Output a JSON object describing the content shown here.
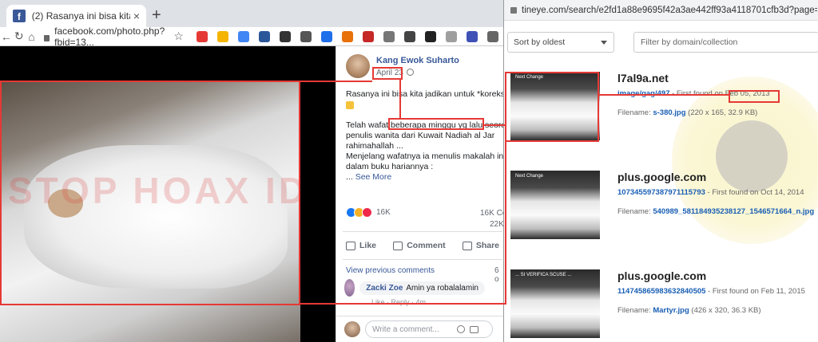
{
  "left_browser": {
    "tab_title": "(2) Rasanya ini bisa kita jadikan",
    "tab_favicon_letter": "f",
    "tab_close": "×",
    "new_tab": "+",
    "url": "facebook.com/photo.php?fbid=13...",
    "back": "←",
    "reload": "↻",
    "home": "⌂",
    "star": "☆"
  },
  "photo": {
    "watermark": "STOP HOAX ID"
  },
  "post": {
    "author": "Kang Ewok Suharto",
    "date": "April 23",
    "line1": "Rasanya ini bisa kita jadikan untuk *koreksi",
    "line3": "Telah wafat beberapa minggu yg lalu seorang",
    "line4": "penulis wanita dari Kuwait Nadiah al Jar",
    "line5": "rahimahallah ...",
    "line6": "Menjelang wafatnya ia menulis makalah ini d",
    "line7": "dalam buku hariannya :",
    "ellipsis": "...",
    "see_more": "See More",
    "reaction_count": "16K",
    "comments_count": "16K Co",
    "shares_count": "22K",
    "like_label": "Like",
    "comment_label": "Comment",
    "share_label": "Share",
    "view_previous": "View previous comments",
    "view_prev_count": "6 o",
    "commenter_name": "Zacki Zoe",
    "comment_text": "Amin ya robalalamin",
    "comment_meta": "Like · Reply · 4m",
    "write_placeholder": "Write a comment..."
  },
  "right_browser": {
    "url": "tineye.com/search/e2fd1a88e9695f42a3ae442ff93a4118701cfb3d?page=1&sor",
    "sort_label": "Sort by oldest",
    "filter_placeholder": "Filter by domain/collection",
    "results": [
      {
        "thumb_caption": "Next Change",
        "domain": "l7al9a.net",
        "link": "image/gag/497",
        "first_found_prefix": " - First found on ",
        "first_found_date": "Feb 05, 2013",
        "filename_label": "Filename: ",
        "filename": "s-380.jpg",
        "size": " (220 x 165, 32.9 KB)"
      },
      {
        "thumb_caption": "Next Change",
        "domain": "plus.google.com",
        "link": "107345597387971115793",
        "first_found_prefix": " - First found on ",
        "first_found_date": "Oct 14, 2014",
        "filename_label": "Filename: ",
        "filename": "540989_581184935238127_1546571664_n.jpg",
        "size": ""
      },
      {
        "thumb_caption": "... SI VERIFICA SCUSE ...",
        "domain": "plus.google.com",
        "link": "114745865983632840505",
        "first_found_prefix": " - First found on ",
        "first_found_date": "Feb 11, 2015",
        "filename_label": "Filename: ",
        "filename": "Martyr.jpg",
        "size": " (426 x 320, 36.3 KB)"
      }
    ]
  },
  "colors": {
    "annotation": "#e53935",
    "fb_blue": "#385898",
    "tineye_link": "#1a5fb4"
  }
}
